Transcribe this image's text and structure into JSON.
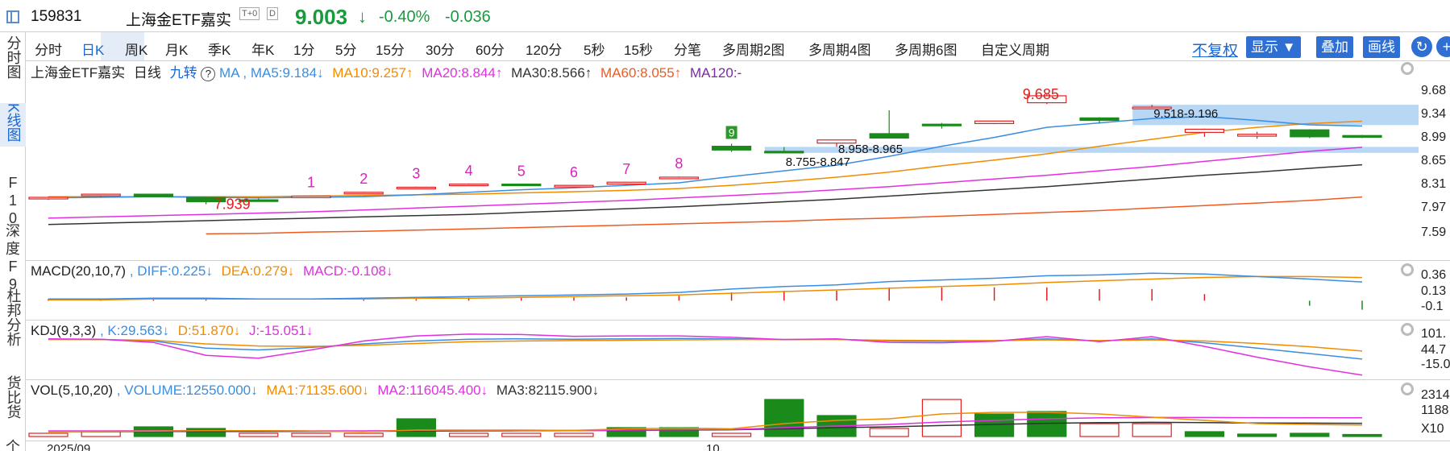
{
  "header": {
    "code": "159831",
    "name": "上海金ETF嘉实",
    "badges": [
      "T+0",
      "D"
    ],
    "price": "9.003",
    "arrow": "↓",
    "pct_change": "-0.40%",
    "change": "-0.036"
  },
  "sidebar": [
    "分时图",
    "K线图",
    "F10",
    "深度F9",
    "杜邦分析",
    "货比货",
    "个"
  ],
  "tabs": [
    "分时",
    "日K",
    "周K",
    "月K",
    "季K",
    "年K",
    "1分",
    "5分",
    "15分",
    "30分",
    "60分",
    "120分",
    "5秒",
    "15秒",
    "分笔",
    "多周期2图",
    "多周期4图",
    "多周期6图",
    "自定义周期"
  ],
  "active_tab": "日K",
  "toolbar": {
    "fuquan": "不复权",
    "display": "显示",
    "overlay": "叠加",
    "draw": "画线",
    "refresh_icon": "refresh-icon",
    "plus_icon": "plus-icon"
  },
  "colors": {
    "up": "#e02020",
    "down": "#1a8a1a",
    "ma5": "#3a8de0",
    "ma10": "#f08c00",
    "ma20": "#e030e0",
    "ma30": "#333333",
    "ma60": "#f05a1e",
    "ma120": "#7a2aa0",
    "zone": "#9fcaf2"
  },
  "main_legend": {
    "title": "上海金ETF嘉实",
    "period": "日线",
    "jiuzhuan": "九转",
    "ma": "MA",
    "ma5": "MA5:9.184↓",
    "ma10": "MA10:9.257↑",
    "ma20": "MA20:8.844↑",
    "ma30": "MA30:8.566↑",
    "ma60": "MA60:8.055↑",
    "ma120": "MA120:-"
  },
  "macd_legend": {
    "title": "MACD(20,10,7)",
    "diff": ", DIFF:0.225↓",
    "dea": "DEA:0.279↓",
    "macd": "MACD:-0.108↓"
  },
  "kdj_legend": {
    "title": "KDJ(9,3,3)",
    "k": ", K:29.563↓",
    "d": "D:51.870↓",
    "j": "J:-15.051↓"
  },
  "vol_legend": {
    "title": "VOL(5,10,20)",
    "volume": ", VOLUME:12550.000↓",
    "ma1": "MA1:71135.600↓",
    "ma2": "MA2:116045.400↓",
    "ma3": "MA3:82115.900↓"
  },
  "axes": {
    "price_ticks": [
      "9.68",
      "9.34",
      "8.99",
      "8.65",
      "8.31",
      "7.97",
      "7.59"
    ],
    "macd_ticks": [
      "0.36",
      "0.13",
      "-0.1"
    ],
    "kdj_ticks": [
      "101.",
      "44.7",
      "-15.0"
    ],
    "vol_ticks": [
      "2314",
      "1188",
      "X10"
    ],
    "date_labels": [
      "2025/09",
      "10"
    ]
  },
  "chart_data": {
    "type": "candlestick",
    "ylim": [
      7.45,
      9.8
    ],
    "candles": [
      {
        "o": 8.03,
        "h": 8.06,
        "l": 8.01,
        "c": 8.05
      },
      {
        "o": 8.08,
        "h": 8.1,
        "l": 8.06,
        "c": 8.1
      },
      {
        "o": 8.1,
        "h": 8.1,
        "l": 8.05,
        "c": 8.06
      },
      {
        "o": 8.05,
        "h": 8.06,
        "l": 7.939,
        "c": 7.98
      },
      {
        "o": 8.01,
        "h": 8.03,
        "l": 7.99,
        "c": 8.0
      },
      {
        "o": 8.07,
        "h": 8.08,
        "l": 8.05,
        "c": 8.07
      },
      {
        "o": 8.11,
        "h": 8.14,
        "l": 8.1,
        "c": 8.13
      },
      {
        "o": 8.19,
        "h": 8.22,
        "l": 8.18,
        "c": 8.21
      },
      {
        "o": 8.25,
        "h": 8.27,
        "l": 8.23,
        "c": 8.26
      },
      {
        "o": 8.26,
        "h": 8.26,
        "l": 8.23,
        "c": 8.24
      },
      {
        "o": 8.23,
        "h": 8.24,
        "l": 8.22,
        "c": 8.24
      },
      {
        "o": 8.26,
        "h": 8.29,
        "l": 8.25,
        "c": 8.29
      },
      {
        "o": 8.35,
        "h": 8.38,
        "l": 8.34,
        "c": 8.37
      },
      {
        "o": 8.86,
        "h": 8.9,
        "l": 8.77,
        "c": 8.8
      },
      {
        "o": 8.78,
        "h": 8.847,
        "l": 8.755,
        "c": 8.77
      },
      {
        "o": 8.91,
        "h": 8.965,
        "l": 8.85,
        "c": 8.96
      },
      {
        "o": 9.06,
        "h": 9.43,
        "l": 8.99,
        "c": 8.99
      },
      {
        "o": 9.21,
        "h": 9.23,
        "l": 9.14,
        "c": 9.19
      },
      {
        "o": 9.22,
        "h": 9.26,
        "l": 9.21,
        "c": 9.26
      },
      {
        "o": 9.55,
        "h": 9.685,
        "l": 9.53,
        "c": 9.66
      },
      {
        "o": 9.31,
        "h": 9.32,
        "l": 9.22,
        "c": 9.27
      },
      {
        "o": 9.48,
        "h": 9.518,
        "l": 9.45,
        "c": 9.48
      },
      {
        "o": 9.08,
        "h": 9.14,
        "l": 9.01,
        "c": 9.13
      },
      {
        "o": 9.02,
        "h": 9.09,
        "l": 8.98,
        "c": 9.05
      },
      {
        "o": 9.12,
        "h": 9.13,
        "l": 8.99,
        "c": 9.01
      },
      {
        "o": 9.03,
        "h": 9.04,
        "l": 8.99,
        "c": 9.003
      }
    ],
    "jiuzhuan_marks": [
      {
        "i": 5,
        "label": "1"
      },
      {
        "i": 6,
        "label": "2"
      },
      {
        "i": 7,
        "label": "3"
      },
      {
        "i": 8,
        "label": "4"
      },
      {
        "i": 9,
        "label": "5"
      },
      {
        "i": 10,
        "label": "6"
      },
      {
        "i": 11,
        "label": "7"
      },
      {
        "i": 12,
        "label": "8"
      },
      {
        "i": 13,
        "label": "9"
      }
    ],
    "annotations": [
      {
        "text": "7.939",
        "i": 3,
        "y": 7.939
      },
      {
        "text": "8.755-8.847",
        "i": 14,
        "y": 8.755
      },
      {
        "text": "8.958-8.965",
        "i": 15,
        "y": 8.958
      },
      {
        "text": "9.685",
        "i": 19,
        "y": 9.685
      },
      {
        "text": "9.518-9.196",
        "i": 21,
        "y": 9.518
      }
    ],
    "zones": [
      {
        "from_i": 21,
        "y1": 9.518,
        "y2": 9.196
      },
      {
        "from_i": 14,
        "y1": 8.85,
        "y2": 8.755
      }
    ],
    "ma5": [
      8.04,
      8.05,
      8.06,
      8.05,
      8.04,
      8.05,
      8.06,
      8.09,
      8.13,
      8.17,
      8.2,
      8.24,
      8.28,
      8.38,
      8.47,
      8.56,
      8.7,
      8.86,
      9.0,
      9.16,
      9.23,
      9.3,
      9.33,
      9.27,
      9.2,
      9.18
    ],
    "ma10": [
      8.06,
      8.06,
      8.06,
      8.06,
      8.06,
      8.07,
      8.08,
      8.09,
      8.1,
      8.12,
      8.14,
      8.16,
      8.19,
      8.24,
      8.3,
      8.37,
      8.45,
      8.55,
      8.64,
      8.74,
      8.86,
      8.97,
      9.08,
      9.16,
      9.22,
      9.257
    ],
    "ma20": [
      7.72,
      7.74,
      7.76,
      7.78,
      7.8,
      7.82,
      7.85,
      7.88,
      7.91,
      7.94,
      7.97,
      8.0,
      8.04,
      8.08,
      8.12,
      8.17,
      8.22,
      8.28,
      8.34,
      8.4,
      8.47,
      8.54,
      8.62,
      8.7,
      8.78,
      8.844
    ],
    "ma30": [
      7.62,
      7.64,
      7.66,
      7.68,
      7.7,
      7.72,
      7.74,
      7.76,
      7.78,
      7.81,
      7.84,
      7.87,
      7.9,
      7.94,
      7.98,
      8.02,
      8.07,
      8.12,
      8.17,
      8.22,
      8.28,
      8.34,
      8.4,
      8.45,
      8.51,
      8.566
    ],
    "ma60": [
      null,
      null,
      null,
      7.47,
      7.48,
      7.5,
      7.51,
      7.53,
      7.55,
      7.57,
      7.59,
      7.61,
      7.63,
      7.65,
      7.67,
      7.7,
      7.72,
      7.75,
      7.78,
      7.81,
      7.84,
      7.88,
      7.92,
      7.96,
      8.0,
      8.055
    ],
    "macd": {
      "ylim": [
        -0.18,
        0.42
      ],
      "diff": [
        0.02,
        0.02,
        0.03,
        0.03,
        0.02,
        0.02,
        0.03,
        0.04,
        0.05,
        0.06,
        0.07,
        0.08,
        0.1,
        0.14,
        0.17,
        0.19,
        0.23,
        0.25,
        0.27,
        0.3,
        0.31,
        0.33,
        0.32,
        0.29,
        0.26,
        0.225
      ],
      "dea": [
        0.01,
        0.01,
        0.02,
        0.02,
        0.02,
        0.02,
        0.02,
        0.03,
        0.03,
        0.04,
        0.05,
        0.06,
        0.07,
        0.09,
        0.11,
        0.13,
        0.15,
        0.17,
        0.19,
        0.22,
        0.24,
        0.26,
        0.28,
        0.29,
        0.29,
        0.279
      ],
      "hist": [
        0.02,
        0.02,
        0.02,
        0.02,
        0.0,
        0.0,
        0.02,
        0.02,
        0.04,
        0.04,
        0.04,
        0.04,
        0.06,
        0.1,
        0.12,
        0.12,
        0.16,
        0.16,
        0.16,
        0.16,
        0.14,
        0.14,
        0.08,
        0.0,
        -0.06,
        -0.108
      ]
    },
    "kdj": {
      "ylim": [
        -20,
        110
      ],
      "k": [
        85,
        84,
        80,
        60,
        55,
        62,
        72,
        80,
        85,
        86,
        85,
        86,
        87,
        86,
        84,
        85,
        80,
        79,
        80,
        86,
        80,
        86,
        75,
        60,
        45,
        29.563
      ],
      "d": [
        84,
        84,
        82,
        72,
        66,
        65,
        68,
        73,
        78,
        80,
        81,
        82,
        83,
        84,
        84,
        84,
        82,
        81,
        81,
        83,
        81,
        83,
        80,
        73,
        64,
        51.87
      ],
      "j": [
        86,
        85,
        76,
        40,
        32,
        55,
        80,
        94,
        99,
        98,
        93,
        94,
        94,
        90,
        84,
        86,
        76,
        75,
        79,
        92,
        78,
        92,
        65,
        35,
        8,
        -15.051
      ]
    },
    "volume": {
      "ylim": [
        0,
        240000
      ],
      "values": [
        20000,
        30000,
        60000,
        50000,
        20000,
        20000,
        20000,
        110000,
        20000,
        20000,
        20000,
        55000,
        55000,
        20000,
        230000,
        130000,
        50000,
        230000,
        140000,
        155000,
        80000,
        80000,
        30000,
        15000,
        20000,
        12550
      ],
      "up": [
        true,
        true,
        false,
        false,
        true,
        true,
        true,
        false,
        true,
        true,
        true,
        false,
        false,
        true,
        false,
        false,
        true,
        true,
        false,
        false,
        true,
        true,
        false,
        false,
        false,
        false
      ],
      "ma1": [
        30000,
        32000,
        34000,
        36000,
        36000,
        34000,
        30000,
        40000,
        40000,
        40000,
        38000,
        48000,
        52000,
        48000,
        80000,
        100000,
        110000,
        140000,
        150000,
        150000,
        140000,
        120000,
        100000,
        80000,
        75000,
        71135.6
      ],
      "ma2": [
        35000,
        35000,
        36000,
        36000,
        36000,
        35000,
        35000,
        38000,
        38000,
        38000,
        38000,
        40000,
        42000,
        44000,
        55000,
        65000,
        75000,
        90000,
        100000,
        110000,
        116000,
        118000,
        118000,
        117000,
        116500,
        116045.4
      ],
      "ma3": [
        30000,
        30000,
        31000,
        31000,
        31000,
        32000,
        32000,
        34000,
        35000,
        36000,
        37000,
        38000,
        40000,
        42000,
        48000,
        55000,
        60000,
        68000,
        75000,
        82000,
        86000,
        88000,
        86000,
        84000,
        83000,
        82115.9
      ]
    }
  }
}
